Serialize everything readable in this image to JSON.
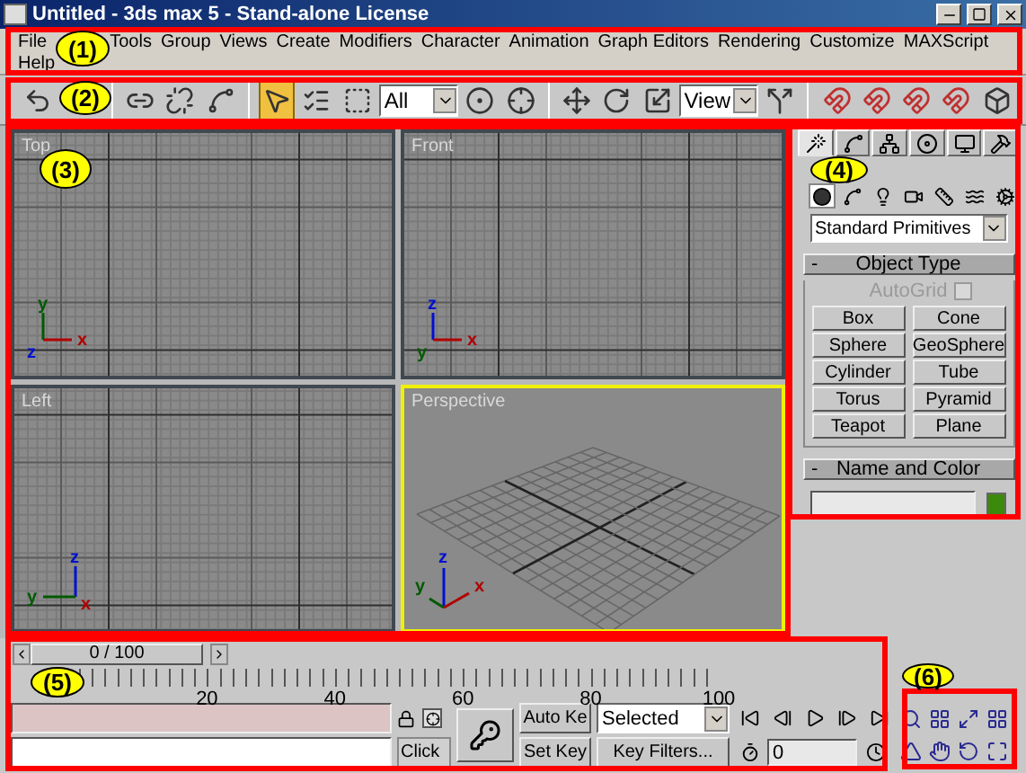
{
  "window": {
    "title": "Untitled - 3ds max 5 - Stand-alone License"
  },
  "menu": [
    {
      "label": "File"
    },
    {
      "label": "Tools"
    },
    {
      "label": "Group"
    },
    {
      "label": "Views"
    },
    {
      "label": "Create"
    },
    {
      "label": "Modifiers"
    },
    {
      "label": "Character"
    },
    {
      "label": "Animation"
    },
    {
      "label": "Graph Editors"
    },
    {
      "label": "Rendering"
    },
    {
      "label": "Customize"
    },
    {
      "label": "MAXScript"
    },
    {
      "label": "Help"
    }
  ],
  "toolbar": [
    {
      "kind": "button",
      "selected": false
    },
    {
      "kind": "separator"
    },
    {
      "kind": "button",
      "selected": false
    },
    {
      "kind": "button",
      "selected": false
    },
    {
      "kind": "button",
      "selected": false
    },
    {
      "kind": "separator"
    },
    {
      "kind": "button",
      "selected": true
    },
    {
      "kind": "button",
      "selected": false
    },
    {
      "kind": "button",
      "selected": false
    },
    {
      "kind": "dropdown",
      "value": "All"
    },
    {
      "kind": "button",
      "selected": false
    },
    {
      "kind": "button",
      "selected": false
    },
    {
      "kind": "separator"
    },
    {
      "kind": "button",
      "selected": false
    },
    {
      "kind": "button",
      "selected": false
    },
    {
      "kind": "button",
      "selected": false
    },
    {
      "kind": "dropdown",
      "value": "View"
    },
    {
      "kind": "button",
      "selected": false
    },
    {
      "kind": "separator"
    },
    {
      "kind": "button",
      "selected": false
    },
    {
      "kind": "button",
      "selected": false
    },
    {
      "kind": "button",
      "selected": false
    },
    {
      "kind": "button",
      "selected": false
    },
    {
      "kind": "button",
      "selected": false
    }
  ],
  "viewports": [
    {
      "label": "Top",
      "kind": "top",
      "active": false,
      "tripod": [
        "y",
        "x",
        "z"
      ]
    },
    {
      "label": "Front",
      "kind": "front",
      "active": false,
      "tripod": [
        "z",
        "x",
        "y"
      ]
    },
    {
      "label": "Left",
      "kind": "left",
      "active": false,
      "tripod": [
        "z",
        "y",
        "x"
      ]
    },
    {
      "label": "Perspective",
      "kind": "perspective",
      "active": true,
      "tripod": [
        "z",
        "x",
        "y"
      ]
    }
  ],
  "command_panel": {
    "tabs": [
      {
        "selected": true
      },
      {
        "selected": false
      },
      {
        "selected": false
      },
      {
        "selected": false
      },
      {
        "selected": false
      },
      {
        "selected": false
      }
    ],
    "categories": [
      {
        "selected": true
      },
      {
        "selected": false
      },
      {
        "selected": false
      },
      {
        "selected": false
      },
      {
        "selected": false
      },
      {
        "selected": false
      },
      {
        "selected": false
      }
    ],
    "dropdown": "Standard Primitives",
    "object_type": {
      "sign": "-",
      "title": "Object Type",
      "autogrid": {
        "label": "AutoGrid",
        "checked": false,
        "disabled": true
      },
      "buttons": [
        "Box",
        "Cone",
        "Sphere",
        "GeoSphere",
        "Cylinder",
        "Tube",
        "Torus",
        "Pyramid",
        "Teapot",
        "Plane"
      ]
    },
    "name_and_color": {
      "sign": "-",
      "title": "Name and Color",
      "color": "#3c8a0c"
    }
  },
  "time_slider": {
    "position": "0 / 100",
    "level": 0
  },
  "track": {
    "labels": [
      "20",
      "40",
      "60",
      "80",
      "100"
    ]
  },
  "status": {
    "prompt": "Click"
  },
  "animation": {
    "auto_key": "Auto Ke",
    "set_key": "Set Key",
    "key_mode": "Selected",
    "key_filters": "Key Filters...",
    "frame": "0"
  },
  "callouts": [
    "(1)",
    "(2)",
    "(3)",
    "(4)",
    "(5)",
    "(6)"
  ]
}
